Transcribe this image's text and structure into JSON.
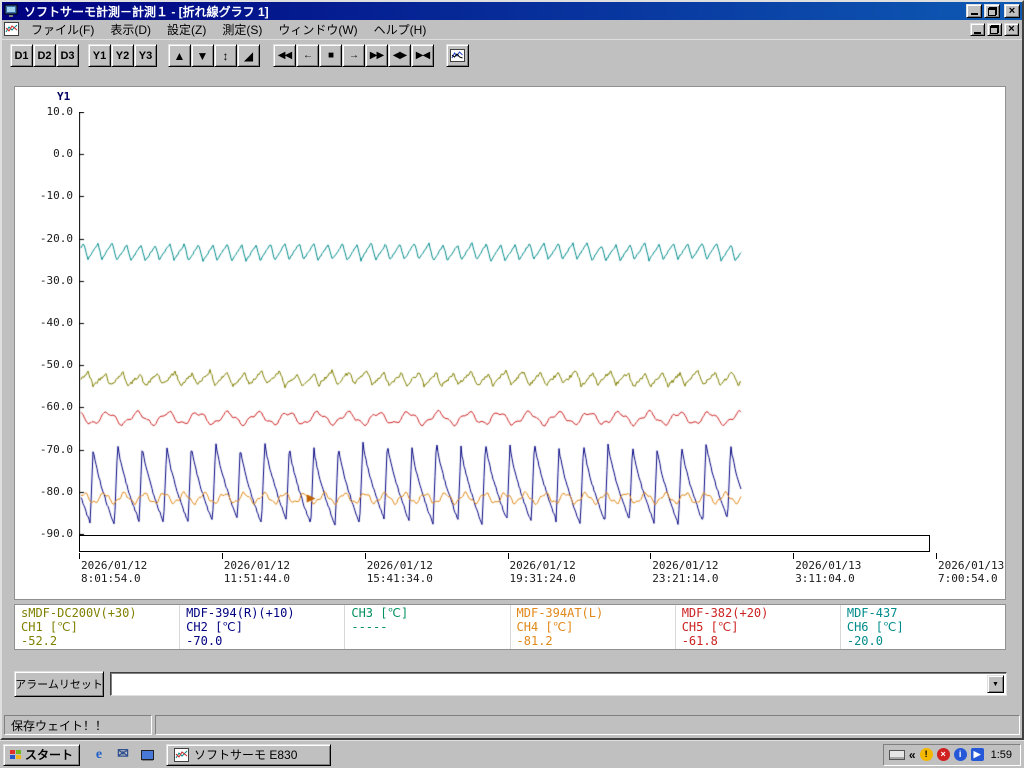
{
  "window": {
    "title": "ソフトサーモ計測－計測１ - [折れ線グラフ 1]",
    "controls": [
      "minimize",
      "restore",
      "close"
    ],
    "mdi_controls": [
      "minimize",
      "restore",
      "close"
    ]
  },
  "menu": {
    "items": [
      {
        "name": "menu-file",
        "label": "ファイル(F)"
      },
      {
        "name": "menu-view",
        "label": "表示(D)"
      },
      {
        "name": "menu-settings",
        "label": "設定(Z)"
      },
      {
        "name": "menu-measure",
        "label": "測定(S)"
      },
      {
        "name": "menu-window",
        "label": "ウィンドウ(W)"
      },
      {
        "name": "menu-help",
        "label": "ヘルプ(H)"
      }
    ]
  },
  "toolbar": {
    "d_buttons": [
      {
        "name": "d1-button",
        "label": "D1"
      },
      {
        "name": "d2-button",
        "label": "D2"
      },
      {
        "name": "d3-button",
        "label": "D3"
      }
    ],
    "y_buttons": [
      {
        "name": "y1-button",
        "label": "Y1"
      },
      {
        "name": "y2-button",
        "label": "Y2"
      },
      {
        "name": "y3-button",
        "label": "Y3"
      }
    ],
    "nav_buttons": [
      {
        "name": "scroll-up-button",
        "glyph": "▲"
      },
      {
        "name": "scroll-down-button",
        "glyph": "▼"
      },
      {
        "name": "expand-vertical-button",
        "glyph": "↕"
      },
      {
        "name": "auto-scale-button",
        "glyph": "◢"
      }
    ],
    "playback_buttons": [
      {
        "name": "rewind-button",
        "glyph": "◀◀"
      },
      {
        "name": "step-back-button",
        "glyph": "←"
      },
      {
        "name": "stop-button",
        "glyph": "■"
      },
      {
        "name": "step-forward-button",
        "glyph": "→"
      },
      {
        "name": "fast-forward-button",
        "glyph": "▶▶"
      },
      {
        "name": "zoom-out-time-button",
        "glyph": "◀▶"
      },
      {
        "name": "zoom-in-time-button",
        "glyph": "▶◀"
      }
    ],
    "extra_button_icon": "mini-graph-icon"
  },
  "chart_data": {
    "type": "line",
    "title": "折れ線グラフ 1",
    "grid": false,
    "y_axis": {
      "label": "Y1",
      "min": -90,
      "max": 10,
      "ticks": [
        "10.0",
        "0.0",
        "-10.0",
        "-20.0",
        "-30.0",
        "-40.0",
        "-50.0",
        "-60.0",
        "-70.0",
        "-80.0",
        "-90.0"
      ]
    },
    "x_axis": {
      "ticks": [
        {
          "date": "2026/01/12",
          "time": "8:01:54.0"
        },
        {
          "date": "2026/01/12",
          "time": "11:51:44.0"
        },
        {
          "date": "2026/01/12",
          "time": "15:41:34.0"
        },
        {
          "date": "2026/01/12",
          "time": "19:31:24.0"
        },
        {
          "date": "2026/01/12",
          "time": "23:21:14.0"
        },
        {
          "date": "2026/01/13",
          "time": "3:11:04.0"
        },
        {
          "date": "2026/01/13",
          "time": "7:00:54.0"
        }
      ]
    },
    "data_end_fraction": 0.772,
    "series": [
      {
        "id": "CH1",
        "shape": "sawtooth",
        "color": "#808000",
        "base": -54.6,
        "amplitude": 3.0,
        "cycles": 38,
        "noise": 0.4,
        "cycle_jitter": 0.4,
        "phase": 0.2
      },
      {
        "id": "CH2",
        "shape": "spike",
        "color": "#000080",
        "min": -87,
        "peak": -68.5,
        "cycles": 27,
        "noise": 0.3,
        "cycle_jitter": 0.9,
        "phase": 0.55
      },
      {
        "id": "CH4",
        "shape": "wave",
        "color": "#e08818",
        "base": -81.3,
        "amplitude": 1.1,
        "cycles": 33,
        "noise": 0.15,
        "cycle_jitter": 0,
        "phase": 0
      },
      {
        "id": "CH5",
        "shape": "wave",
        "color": "#cc2222",
        "base": -62.4,
        "amplitude": 1.3,
        "cycles": 22,
        "noise": 0.15,
        "cycle_jitter": 0,
        "phase": 0.3
      },
      {
        "id": "CH6",
        "shape": "sawtooth",
        "color": "#008b8b",
        "base": -25.0,
        "amplitude": 3.8,
        "cycles": 46,
        "noise": 0.2,
        "cycle_jitter": 0.3,
        "phase": 0.4
      }
    ],
    "cursor_marker": {
      "series": "CH4",
      "x_fraction": 0.35,
      "value": -81.4,
      "color": "#c06000"
    }
  },
  "legend": {
    "channels": [
      {
        "id": "CH1",
        "label": "sMDF-DC200V(+30)",
        "channel": "CH1 [℃]",
        "value": "-52.2",
        "color": "#808000"
      },
      {
        "id": "CH2",
        "label": "MDF-394(R)(+10)",
        "channel": "CH2 [℃]",
        "value": "-70.0",
        "color": "#000080"
      },
      {
        "id": "CH3",
        "label": "",
        "channel": "CH3 [℃]",
        "value": "-----",
        "color": "#009060"
      },
      {
        "id": "CH4",
        "label": "MDF-394AT(L)",
        "channel": "CH4 [℃]",
        "value": "-81.2",
        "color": "#e08818"
      },
      {
        "id": "CH5",
        "label": "MDF-382(+20)",
        "channel": "CH5 [℃]",
        "value": "-61.8",
        "color": "#cc2222"
      },
      {
        "id": "CH6",
        "label": "MDF-437",
        "channel": "CH6 [℃]",
        "value": "-20.0",
        "color": "#008b8b"
      }
    ]
  },
  "alarm": {
    "reset_label": "アラームリセット",
    "combo_value": ""
  },
  "status": {
    "text": "保存ウェイト！！"
  },
  "taskbar": {
    "start_label": "スタート",
    "flag_colors": [
      "#e03028",
      "#70b820",
      "#2858c8",
      "#f0b818"
    ],
    "quick_launch": [
      {
        "name": "internet-explorer-icon",
        "shape": "letter",
        "glyph": "e",
        "color": "#2060c8"
      },
      {
        "name": "mail-icon",
        "shape": "letter",
        "glyph": "✉",
        "color": "#305090"
      },
      {
        "name": "show-desktop-icon",
        "shape": "monitor"
      }
    ],
    "task_label": "ソフトサーモ E830",
    "tray_icons": [
      {
        "name": "keyboard-icon",
        "shape": "keyboard"
      },
      {
        "name": "hide-notification-icons-button",
        "shape": "chevron",
        "glyph": "«"
      },
      {
        "name": "update-alert-icon",
        "shape": "circle",
        "glyph": "!",
        "bg": "#f5b800",
        "fg": "#000000"
      },
      {
        "name": "security-alert-icon",
        "shape": "circle",
        "glyph": "×",
        "bg": "#d02020",
        "fg": "#ffffff"
      },
      {
        "name": "information-icon",
        "shape": "circle",
        "glyph": "i",
        "bg": "#2458d8",
        "fg": "#ffffff"
      },
      {
        "name": "media-player-icon",
        "shape": "square",
        "glyph": "▶",
        "bg": "#2458d8",
        "fg": "#ffffff"
      }
    ],
    "clock": "1:59"
  }
}
